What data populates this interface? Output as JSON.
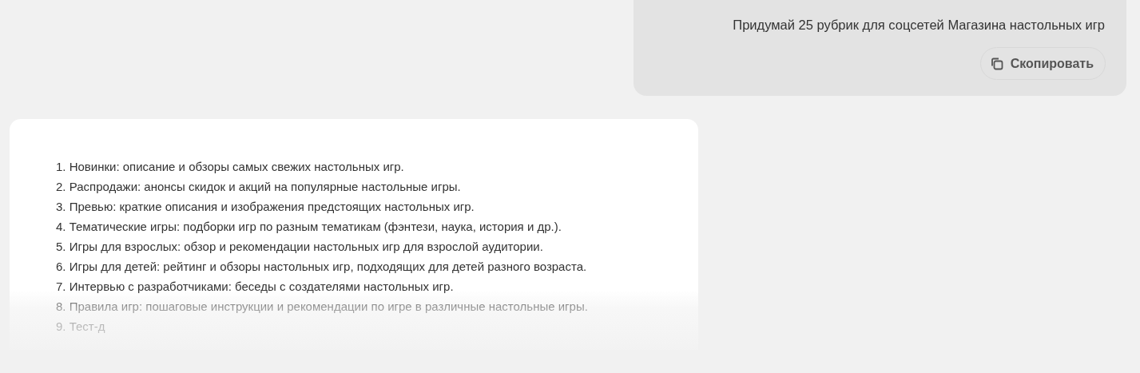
{
  "user_message": {
    "text": "Придумай 25 рубрик для соцсетей Магазина настольных игр",
    "copy_button": "Скопировать"
  },
  "assistant_message": {
    "items": [
      "1. Новинки: описание и обзоры самых свежих настольных игр.",
      "2. Распродажи: анонсы скидок и акций на популярные настольные игры.",
      "3. Превью: краткие описания и изображения предстоящих настольных игр.",
      "4. Тематические игры: подборки игр по разным тематикам (фэнтези, наука, история и др.).",
      "5. Игры для взрослых: обзор и рекомендации настольных игр для взрослой аудитории.",
      "6. Игры для детей: рейтинг и обзоры настольных игр, подходящих для детей разного возраста.",
      "7. Интервью с разработчиками: беседы с создателями настольных игр.",
      "8. Правила игр: пошаговые инструкции и рекомендации по игре в различные настольные игры.",
      "9. Тест-д"
    ]
  }
}
